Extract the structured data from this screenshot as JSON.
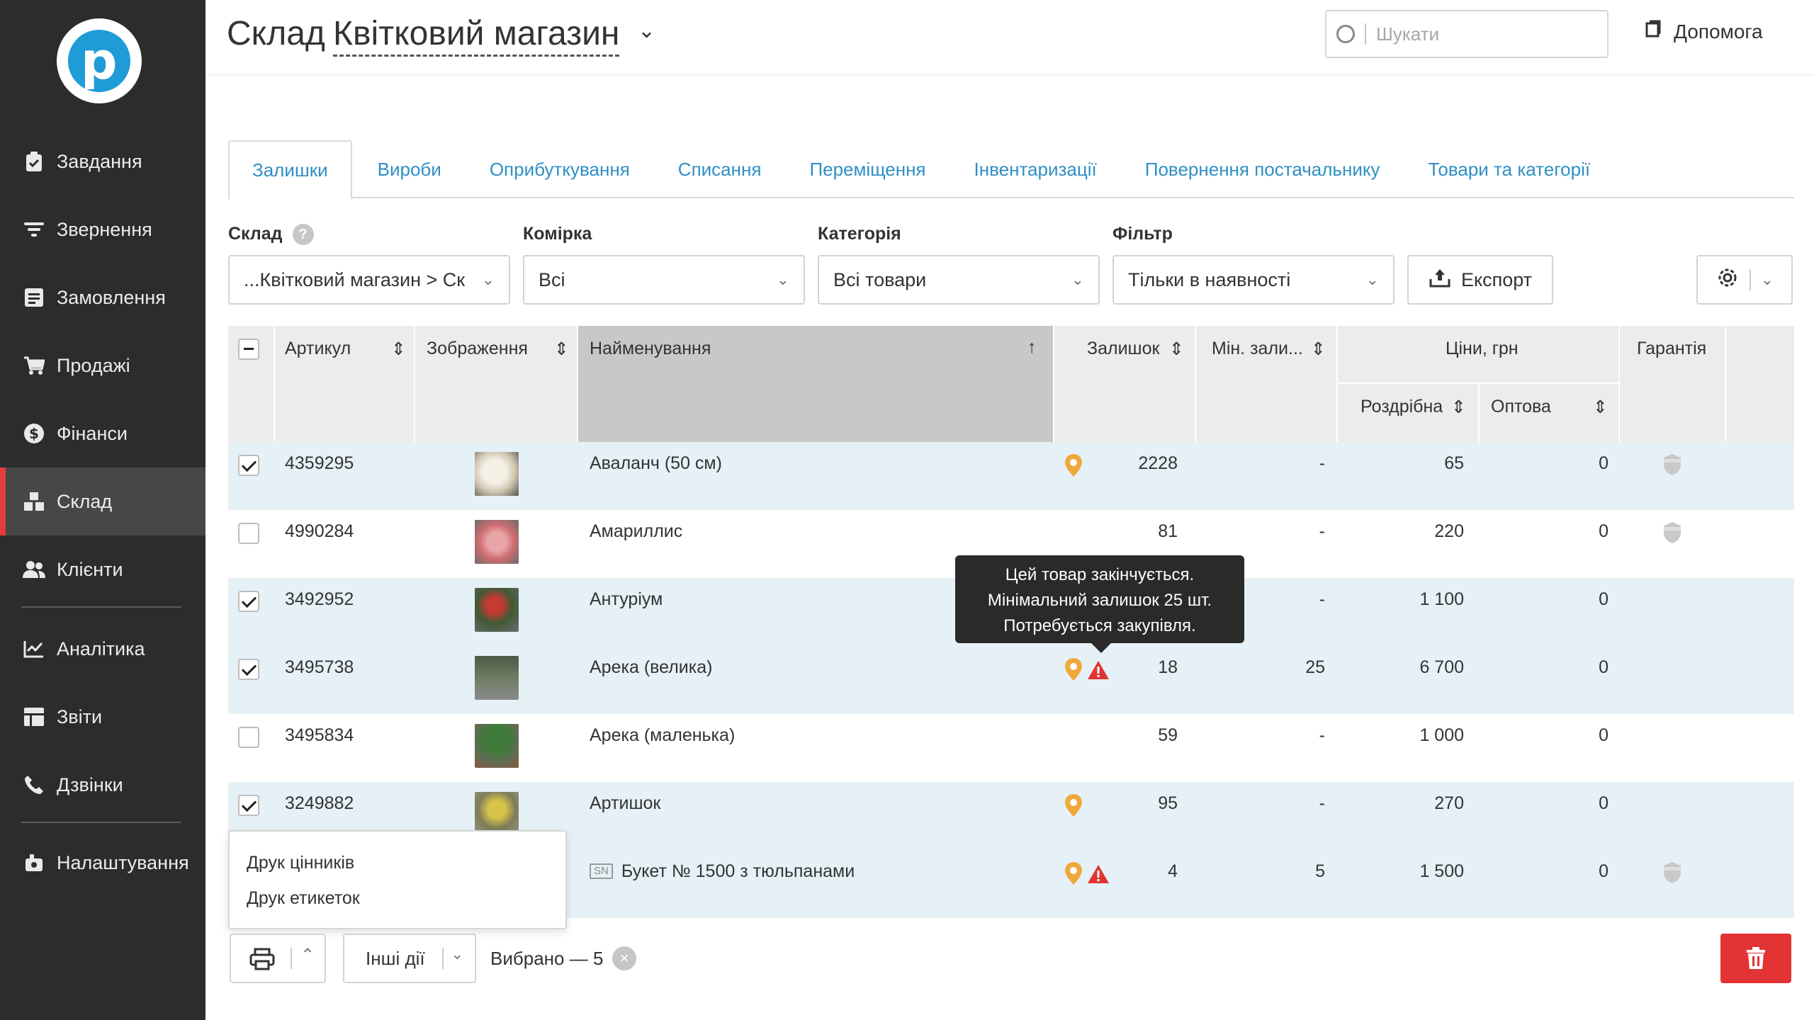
{
  "header": {
    "title_prefix": "Склад",
    "store_name": "Квітковий магазин",
    "search_placeholder": "Шукати",
    "help_label": "Допомога"
  },
  "sidebar": {
    "items": [
      {
        "label": "Завдання",
        "icon": "clipboard-icon"
      },
      {
        "label": "Звернення",
        "icon": "filter-lines-icon"
      },
      {
        "label": "Замовлення",
        "icon": "list-box-icon"
      },
      {
        "label": "Продажі",
        "icon": "cart-icon"
      },
      {
        "label": "Фінанси",
        "icon": "dollar-icon"
      },
      {
        "label": "Склад",
        "icon": "boxes-icon",
        "active": true
      },
      {
        "label": "Клієнти",
        "icon": "users-icon"
      },
      {
        "label": "Аналітика",
        "icon": "chart-icon"
      },
      {
        "label": "Звіти",
        "icon": "report-icon"
      },
      {
        "label": "Дзвінки",
        "icon": "phone-icon"
      },
      {
        "label": "Налаштування",
        "icon": "settings-icon"
      }
    ]
  },
  "tabs": [
    "Залишки",
    "Вироби",
    "Оприбуткування",
    "Списання",
    "Переміщення",
    "Інвентаризації",
    "Повернення постачальнику",
    "Товари та категорії"
  ],
  "filters": {
    "warehouse_label": "Склад",
    "warehouse_value": "...Квітковий магазин > Ск",
    "cell_label": "Комірка",
    "cell_value": "Всі",
    "category_label": "Категорія",
    "category_value": "Всі товари",
    "filter_label": "Фільтр",
    "filter_value": "Тільки в наявності",
    "export_label": "Експорт"
  },
  "table": {
    "headers": {
      "sku": "Артикул",
      "image": "Зображення",
      "name": "Найменування",
      "stock": "Залишок",
      "min_stock": "Мін. зали...",
      "prices": "Ціни, грн",
      "retail": "Роздрібна",
      "wholesale": "Оптова",
      "warranty": "Гарантія"
    },
    "rows": [
      {
        "sku": "4359295",
        "name": "Аваланч (50 см)",
        "stock": "2228",
        "min": "-",
        "retail": "65",
        "wholesale": "0",
        "checked": true,
        "thumb": "#d9d2c2"
      },
      {
        "sku": "4990284",
        "name": "Амариллис",
        "stock": "81",
        "min": "-",
        "retail": "220",
        "wholesale": "0",
        "checked": false,
        "thumb": "#d98a8e"
      },
      {
        "sku": "3492952",
        "name": "Антуріум",
        "stock": "",
        "min": "-",
        "retail": "1 100",
        "wholesale": "0",
        "checked": true,
        "thumb": "#7a3a34"
      },
      {
        "sku": "3495738",
        "name": "Арека (велика)",
        "stock": "18",
        "min": "25",
        "retail": "6 700",
        "wholesale": "0",
        "checked": true,
        "thumb": "#5d6b52"
      },
      {
        "sku": "3495834",
        "name": "Арека (маленька)",
        "stock": "59",
        "min": "-",
        "retail": "1 000",
        "wholesale": "0",
        "checked": false,
        "thumb": "#4f7048"
      },
      {
        "sku": "3249882",
        "name": "Артишок",
        "stock": "95",
        "min": "-",
        "retail": "270",
        "wholesale": "0",
        "checked": true,
        "thumb": "#8a8460"
      },
      {
        "sku": "",
        "name": "Букет № 1500 з тюльпанами",
        "sn_badge": "SN",
        "stock": "4",
        "min": "5",
        "retail": "1 500",
        "wholesale": "0",
        "checked": false
      }
    ]
  },
  "tooltip": {
    "line1": "Цей товар закінчується.",
    "line2": "Мінімальний залишок 25 шт.",
    "line3": "Потребується закупівля."
  },
  "print_menu": {
    "item1": "Друк цінників",
    "item2": "Друк етикеток"
  },
  "bottom_bar": {
    "other_actions": "Інші дії",
    "selected_text": "Вибрано — 5"
  },
  "colors": {
    "sidebar_bg": "#2c2c2c",
    "accent_active": "#e63b3b",
    "link": "#2f8fc4",
    "pin": "#f0a93b",
    "warning": "#e23434",
    "selected_row": "#e6f1f7"
  }
}
